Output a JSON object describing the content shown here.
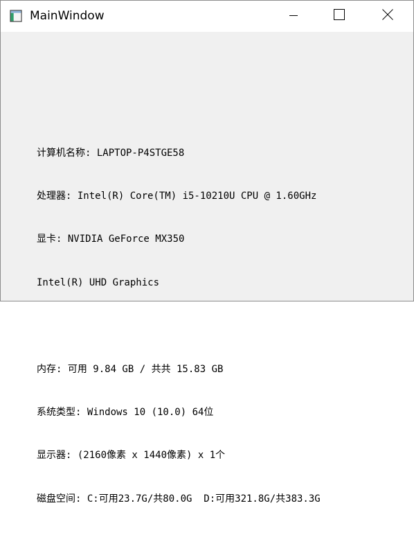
{
  "window": {
    "title": "MainWindow",
    "icon": "app-window-icon",
    "controls": {
      "minimize_icon": "minimize-icon",
      "maximize_icon": "maximize-icon",
      "close_icon": "close-icon"
    }
  },
  "system_info": {
    "computer_name": "计算机名称: LAPTOP-P4STGE58",
    "processor": "处理器: Intel(R) Core(TM) i5-10210U CPU @ 1.60GHz",
    "gpu_primary": "显卡: NVIDIA GeForce MX350",
    "gpu_secondary": "Intel(R) UHD Graphics",
    "memory": "内存: 可用 9.84 GB / 共共 15.83 GB",
    "os_type": "系统类型: Windows 10 (10.0) 64位",
    "display": "显示器: (2160像素 x 1440像素) x 1个",
    "disk": "磁盘空间: C:可用23.7G/共80.0G  D:可用321.8G/共383.3G"
  },
  "colors": {
    "titlebar_bg": "#ffffff",
    "client_bg": "#f0f0f0",
    "border": "#8c8c8c",
    "text": "#000000"
  }
}
